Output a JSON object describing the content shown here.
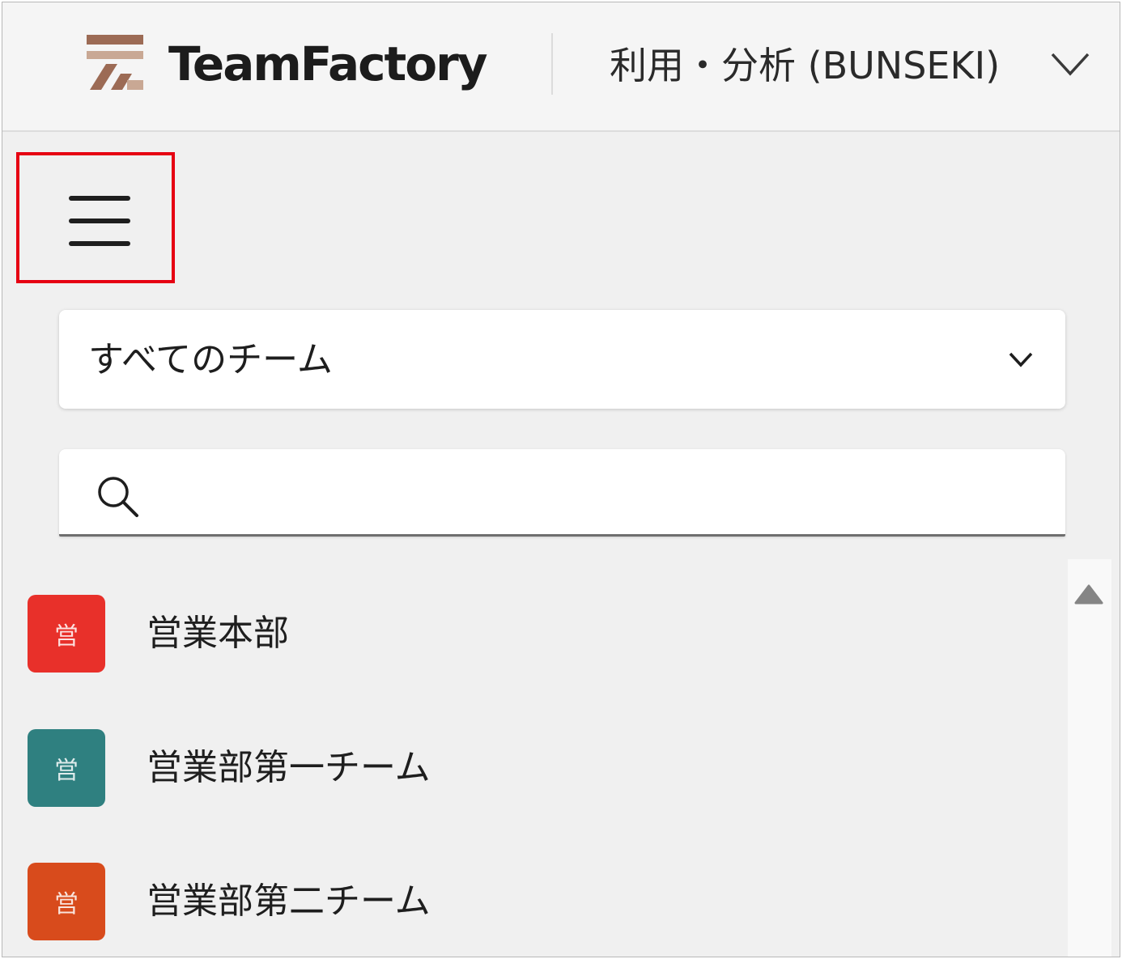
{
  "header": {
    "brand": "TeamFactory",
    "app_name": "利用・分析 (BUNSEKI)",
    "logo_colors": [
      "#9c6b55",
      "#c9a894"
    ]
  },
  "menu": {
    "icon": "hamburger-menu-icon",
    "highlight_color": "#e60012"
  },
  "team_filter": {
    "selected": "すべてのチーム"
  },
  "search": {
    "placeholder": "",
    "value": ""
  },
  "teams": [
    {
      "name": "営業本部",
      "avatar_text": "営",
      "color": "#e8302a"
    },
    {
      "name": "営業部第一チーム",
      "avatar_text": "営",
      "color": "#2f8080"
    },
    {
      "name": "営業部第二チーム",
      "avatar_text": "営",
      "color": "#d84b1c"
    }
  ]
}
